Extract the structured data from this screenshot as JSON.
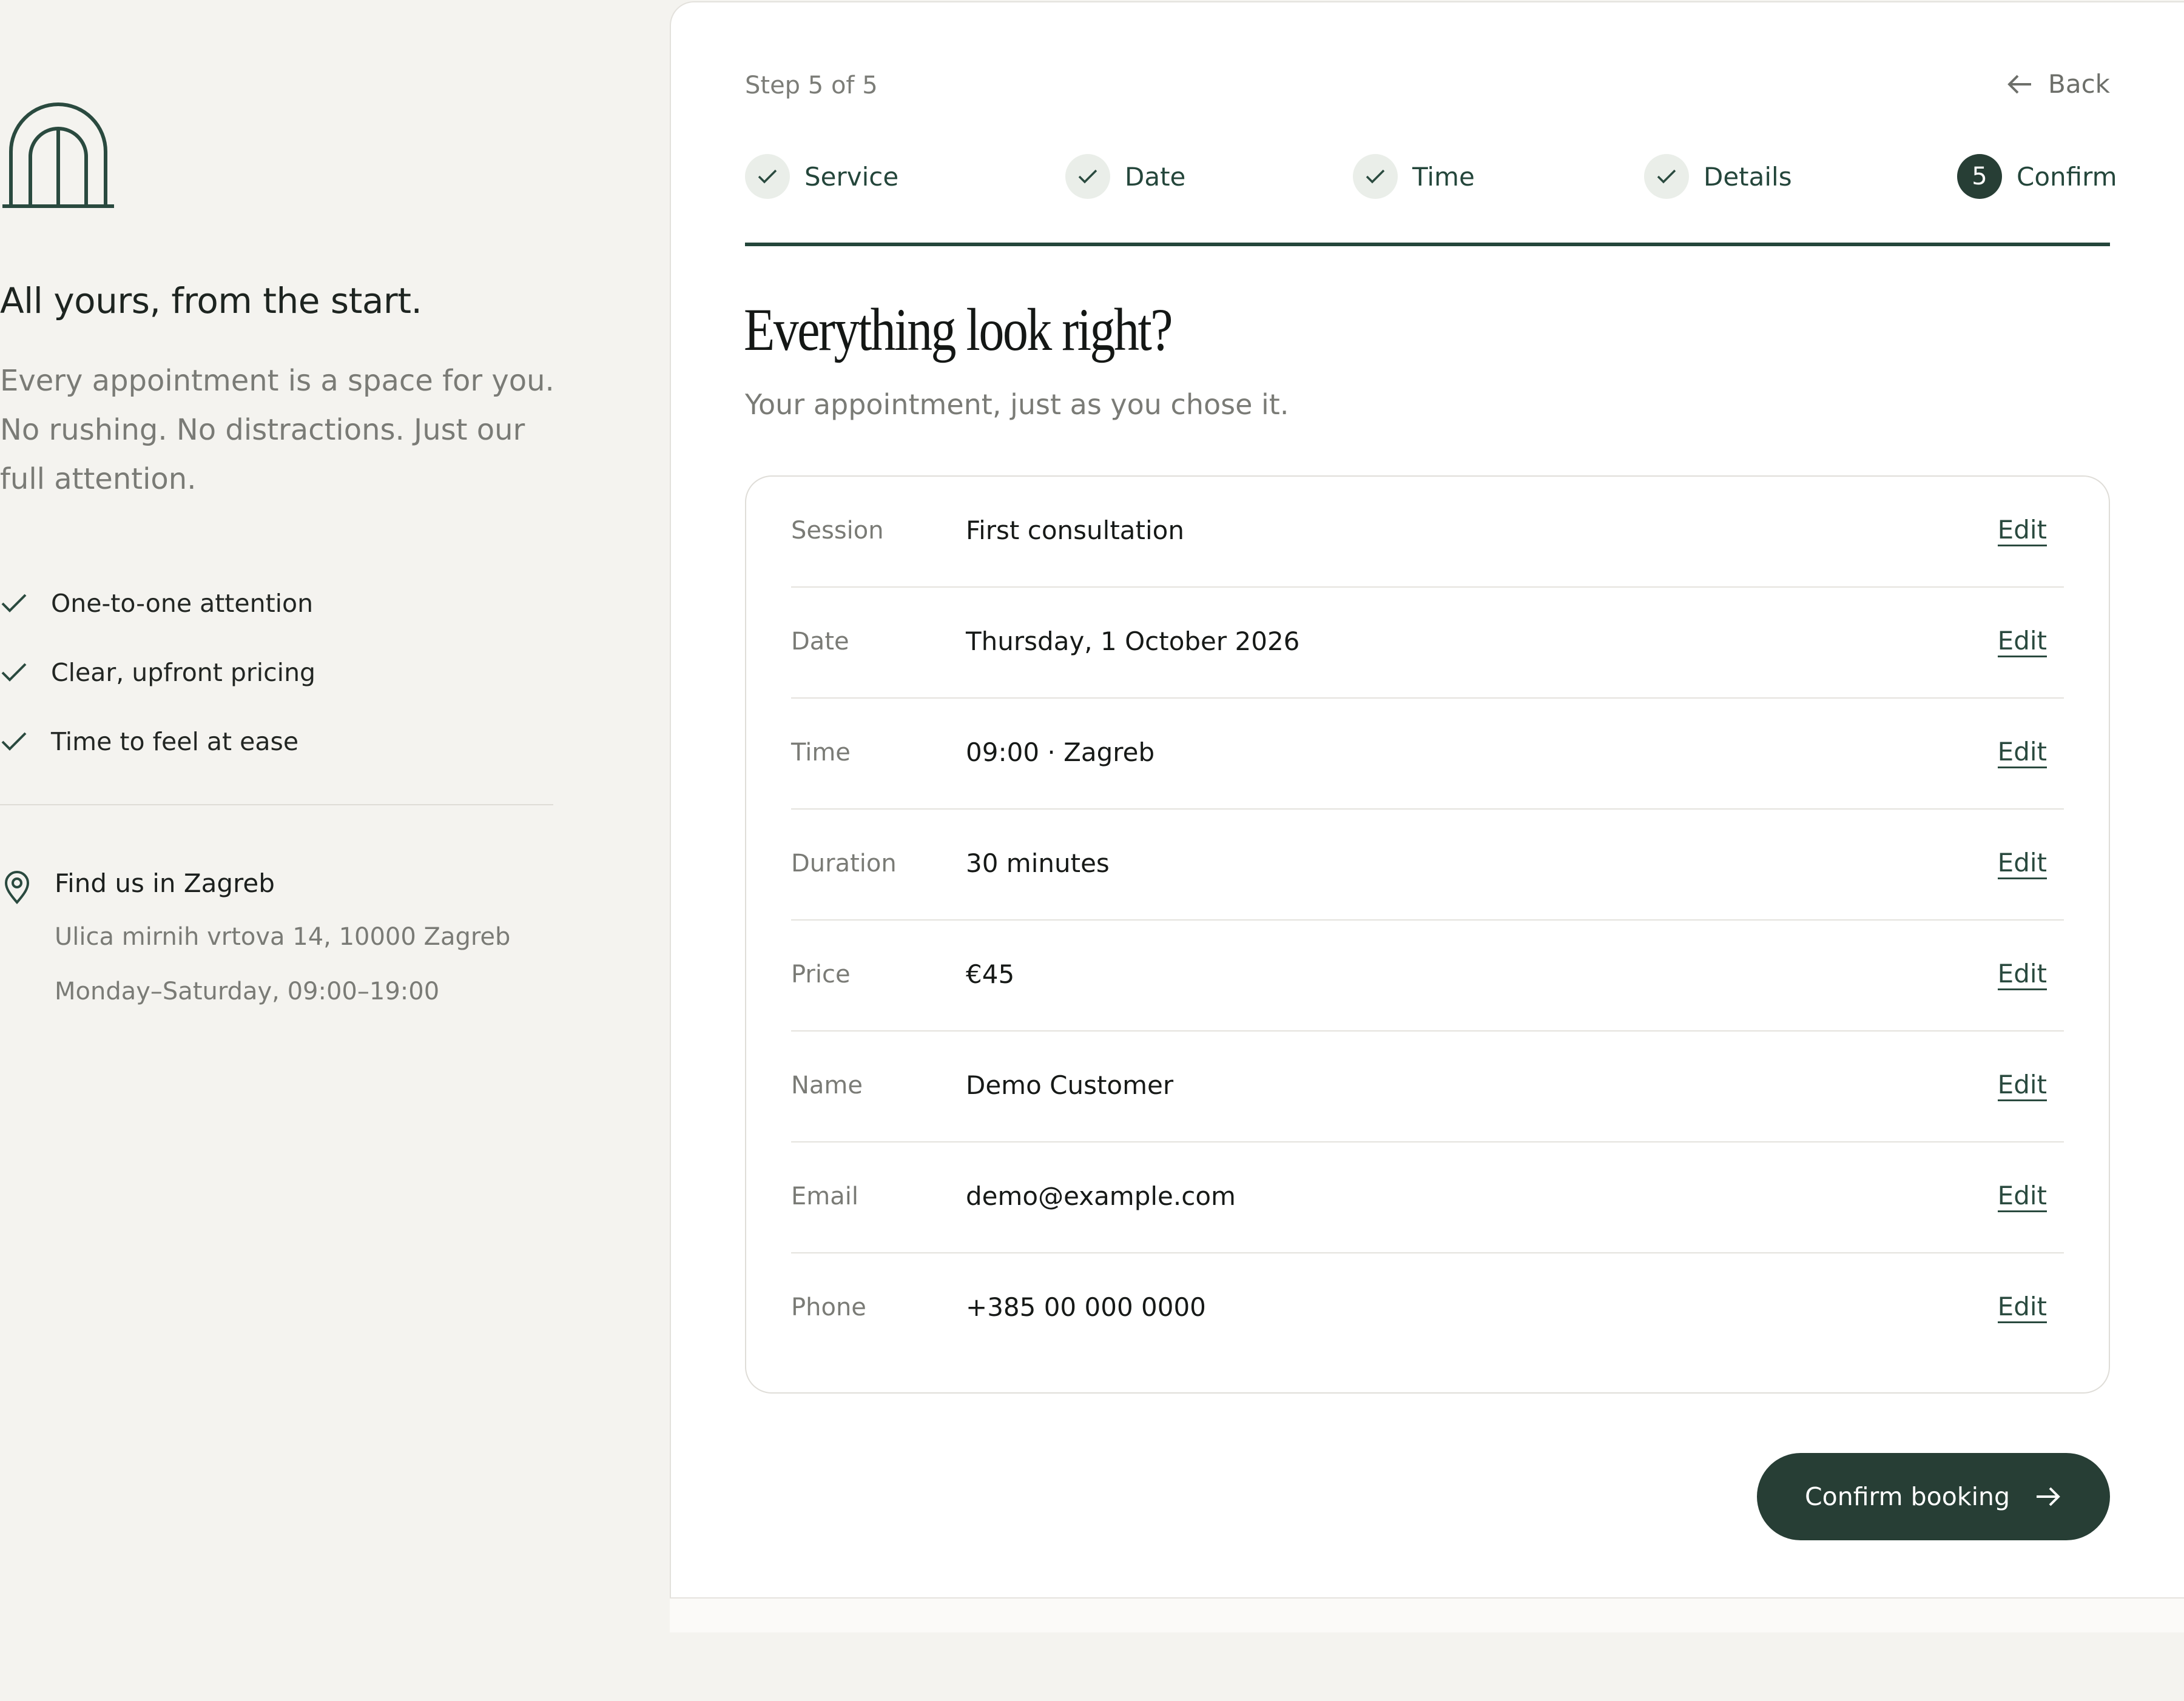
{
  "brand": {
    "logo_icon": "arch-icon",
    "accent": "#273e35"
  },
  "left": {
    "tagline": "All yours, from the start.",
    "intro": "Every appointment is a space for you. No rushing. No distractions. Just our full attention.",
    "features": [
      "One-to-one attention",
      "Clear, upfront pricing",
      "Time to feel at ease"
    ],
    "location": {
      "title": "Find us in Zagreb",
      "address": "Ulica mirnih vrtova 14, 10000 Zagreb",
      "hours": "Monday–Saturday, 09:00–19:00"
    }
  },
  "header": {
    "step_label": "Step 5 of 5",
    "back_label": "Back"
  },
  "stepper": {
    "steps": [
      {
        "label": "Service",
        "state": "done"
      },
      {
        "label": "Date",
        "state": "done"
      },
      {
        "label": "Time",
        "state": "done"
      },
      {
        "label": "Details",
        "state": "done"
      },
      {
        "label": "Confirm",
        "state": "current",
        "number": "5"
      }
    ]
  },
  "main": {
    "title": "Everything look right?",
    "subtitle": "Your appointment, just as you chose it.",
    "edit_label": "Edit",
    "summary": [
      {
        "key": "Session",
        "value": "First consultation"
      },
      {
        "key": "Date",
        "value": "Thursday, 1 October 2026"
      },
      {
        "key": "Time",
        "value": "09:00 · Zagreb"
      },
      {
        "key": "Duration",
        "value": "30 minutes"
      },
      {
        "key": "Price",
        "value": "€45"
      },
      {
        "key": "Name",
        "value": "Demo Customer"
      },
      {
        "key": "Email",
        "value": "demo@example.com"
      },
      {
        "key": "Phone",
        "value": "+385 00 000 0000"
      }
    ],
    "confirm_label": "Confirm booking"
  }
}
